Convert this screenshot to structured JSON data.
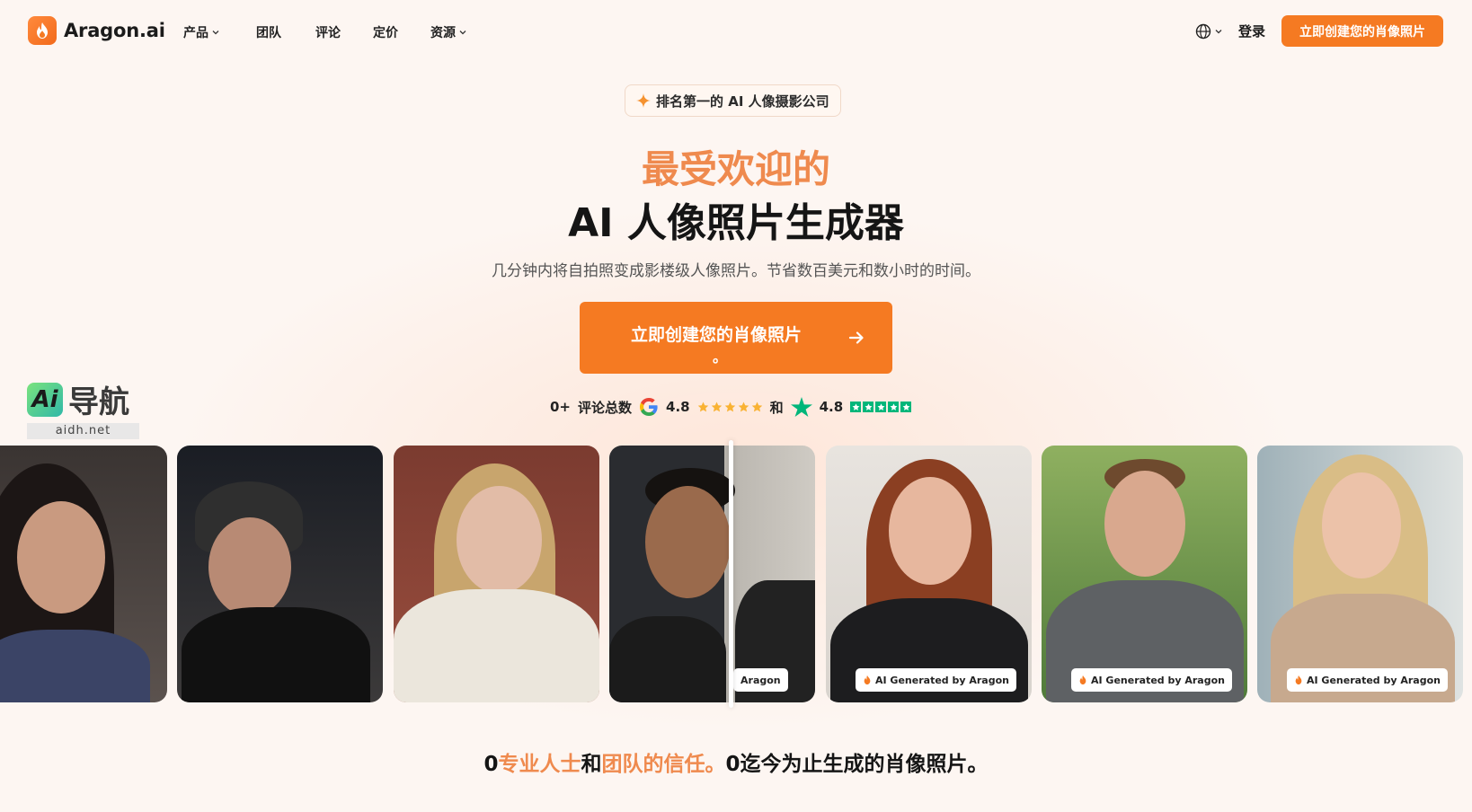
{
  "header": {
    "brand": "Aragon.ai",
    "nav": [
      {
        "label": "产品",
        "has_menu": true
      },
      {
        "label": "团队",
        "has_menu": false
      },
      {
        "label": "评论",
        "has_menu": false
      },
      {
        "label": "定价",
        "has_menu": false
      },
      {
        "label": "资源",
        "has_menu": true
      }
    ],
    "login_label": "登录",
    "cta_label": "立即创建您的肖像照片"
  },
  "hero": {
    "badge": "排名第一的 AI 人像摄影公司",
    "title_accent": "最受欢迎的",
    "title_main": "AI 人像照片生成器",
    "subtitle": "几分钟内将自拍照变成影楼级人像照片。节省数百美元和数小时的时间。",
    "cta_label": "立即创建您的肖像照片",
    "cta_suffix": "。"
  },
  "ratings": {
    "review_count": "0+",
    "review_label": "评论总数",
    "google_score": "4.8",
    "joiner": "和",
    "trustpilot_score": "4.8"
  },
  "watermark": {
    "logo": "Ai",
    "name": "导航",
    "url": "aidh.net"
  },
  "carousel": {
    "ai_tag": "AI Generated by Aragon",
    "ai_tag_partial": "Aragon"
  },
  "trust_line": {
    "count1": "0",
    "part1": "专业人士",
    "and": "和",
    "part2": "团队的信任。",
    "count2": "0",
    "part3": "迄今为止生成的肖像照片。"
  },
  "colors": {
    "accent": "#f57a22",
    "accent_text": "#ef8a4e",
    "background": "#fdf6f2",
    "trustpilot_green": "#00b67a",
    "star_gold": "#f9b233"
  }
}
